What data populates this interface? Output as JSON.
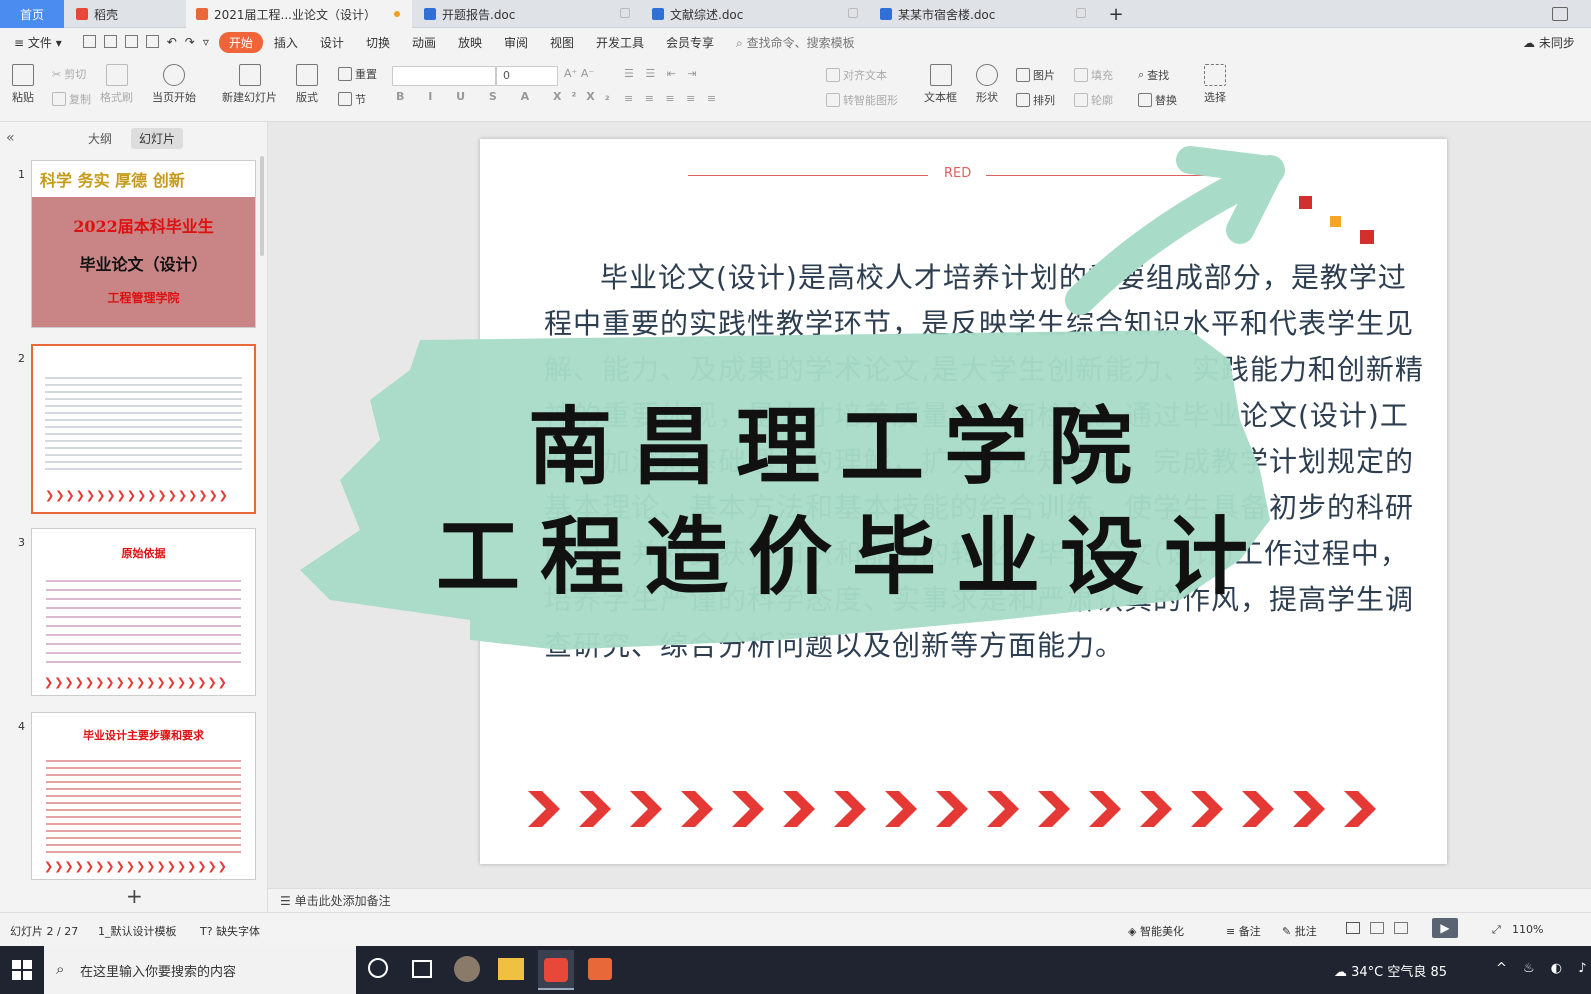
{
  "tabs": {
    "home": "首页",
    "app": "稻壳",
    "active_doc": "2021届工程...业论文（设计）",
    "doc2": "开题报告.doc",
    "doc3": "文献综述.doc",
    "doc4": "某某市宿舍楼.doc",
    "add": "+"
  },
  "menu": {
    "file": "文件",
    "items": [
      "开始",
      "插入",
      "设计",
      "切换",
      "动画",
      "放映",
      "审阅",
      "视图",
      "开发工具",
      "会员专享"
    ],
    "search": "查找命令、搜索模板",
    "sync": "未同步"
  },
  "ribbon": {
    "paste": "粘贴",
    "cut": "剪切",
    "copy": "复制",
    "format_painter": "格式刷",
    "play_from_current": "当页开始",
    "new_slide": "新建幻灯片",
    "layout": "版式",
    "reset": "重置",
    "section": "节",
    "font_size": "0",
    "align_text": "对齐文本",
    "smart_shape": "转智能图形",
    "textbox": "文本框",
    "shape": "形状",
    "picture": "图片",
    "arrange": "排列",
    "fill": "填充",
    "outline": "轮廓",
    "find": "查找",
    "replace": "替换",
    "select": "选择"
  },
  "left_panel": {
    "tab_outline": "大纲",
    "tab_slides": "幻灯片",
    "add": "+",
    "thumbs": [
      {
        "num": "1",
        "top_text": "科学 务实   厚德 创新",
        "title": "2022届本科毕业生",
        "sub": "毕业论文（设计）",
        "dept": "工程管理学院"
      },
      {
        "num": "2"
      },
      {
        "num": "3",
        "title": "原始依据"
      },
      {
        "num": "4",
        "title": "毕业设计主要步骤和要求"
      }
    ]
  },
  "slide": {
    "header": "RED",
    "body": "毕业论文(设计)是高校人才培养计划的重要组成部分，是教学过程中重要的实践性教学环节，是反映学生综合知识水平和代表学生见解、能力、及成果的学术论文,是大学生创新能力、实践能力和创新精神的重要体现，是人才培养质量的全面检验。通过毕业论文(设计)工作，加深对基础理论的理解，扩大专业知识面，完成教学计划规定的基本理论、基本方法和基本技能的综合训练，使学生具备初步的科研能力，并初步获得知识和能力的转化。毕业论文(设计)工作过程中，培养学生严谨的科学态度、实事求是和严肃认真的作风，提高学生调查研究、综合分析问题以及创新等方面能力。"
  },
  "overlay": {
    "line1": "南昌理工学院",
    "line2": "工程造价毕业设计"
  },
  "notes_placeholder": "单击此处添加备注",
  "status": {
    "slide_info": "幻灯片 2 / 27",
    "template": "1_默认设计模板",
    "missing_font": "缺失字体",
    "beautify": "智能美化",
    "notes": "备注",
    "comments": "批注",
    "zoom": "110%"
  },
  "taskbar": {
    "search_placeholder": "在这里输入你要搜索的内容",
    "weather": "34°C  空气良 85"
  },
  "colors": {
    "accent": "#f0643a",
    "home_tab": "#4a8cf0",
    "chevron": "#e53935",
    "brush": "#a8dcc8"
  }
}
